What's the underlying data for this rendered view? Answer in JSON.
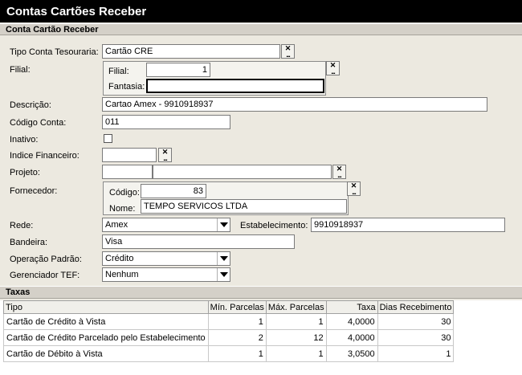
{
  "window": {
    "title": "Contas Cartões Receber"
  },
  "section_conta": {
    "title": "Conta Cartão Receber"
  },
  "fields": {
    "tipo_conta_tesouraria": {
      "label": "Tipo Conta Tesouraria:",
      "value": "Cartão CRE"
    },
    "filial": {
      "label": "Filial:",
      "filial_label": "Filial:",
      "filial_value": "1",
      "fantasia_label": "Fantasia:",
      "fantasia_value": ""
    },
    "descricao": {
      "label": "Descrição:",
      "value": "Cartao Amex - 9910918937"
    },
    "codigo_conta": {
      "label": "Código Conta:",
      "value": "011"
    },
    "inativo": {
      "label": "Inativo:",
      "checked": false
    },
    "indice_financeiro": {
      "label": "Indice Financeiro:",
      "value": ""
    },
    "projeto": {
      "label": "Projeto:",
      "code": "",
      "name": ""
    },
    "fornecedor": {
      "label": "Fornecedor:",
      "codigo_label": "Código:",
      "codigo_value": "83",
      "nome_label": "Nome:",
      "nome_value": "TEMPO SERVICOS LTDA"
    },
    "rede": {
      "label": "Rede:",
      "value": "Amex"
    },
    "estabelecimento": {
      "label": "Estabelecimento:",
      "value": "9910918937"
    },
    "bandeira": {
      "label": "Bandeira:",
      "value": "Visa"
    },
    "operacao_padrao": {
      "label": "Operação Padrão:",
      "value": "Crédito"
    },
    "gerenciador_tef": {
      "label": "Gerenciador TEF:",
      "value": "Nenhum"
    }
  },
  "buttons": {
    "clear_glyph": "✕",
    "dots_glyph": "..."
  },
  "section_taxas": {
    "title": "Taxas"
  },
  "taxas": {
    "columns": [
      "Tipo",
      "Mín. Parcelas",
      "Máx. Parcelas",
      "Taxa",
      "Dias Recebimento"
    ],
    "rows": [
      [
        "Cartão de Crédito à Vista",
        "1",
        "1",
        "4,0000",
        "30"
      ],
      [
        "Cartão de Crédito Parcelado pelo Estabelecimento",
        "2",
        "12",
        "4,0000",
        "30"
      ],
      [
        "Cartão de Débito à Vista",
        "1",
        "1",
        "3,0500",
        "1"
      ]
    ]
  }
}
